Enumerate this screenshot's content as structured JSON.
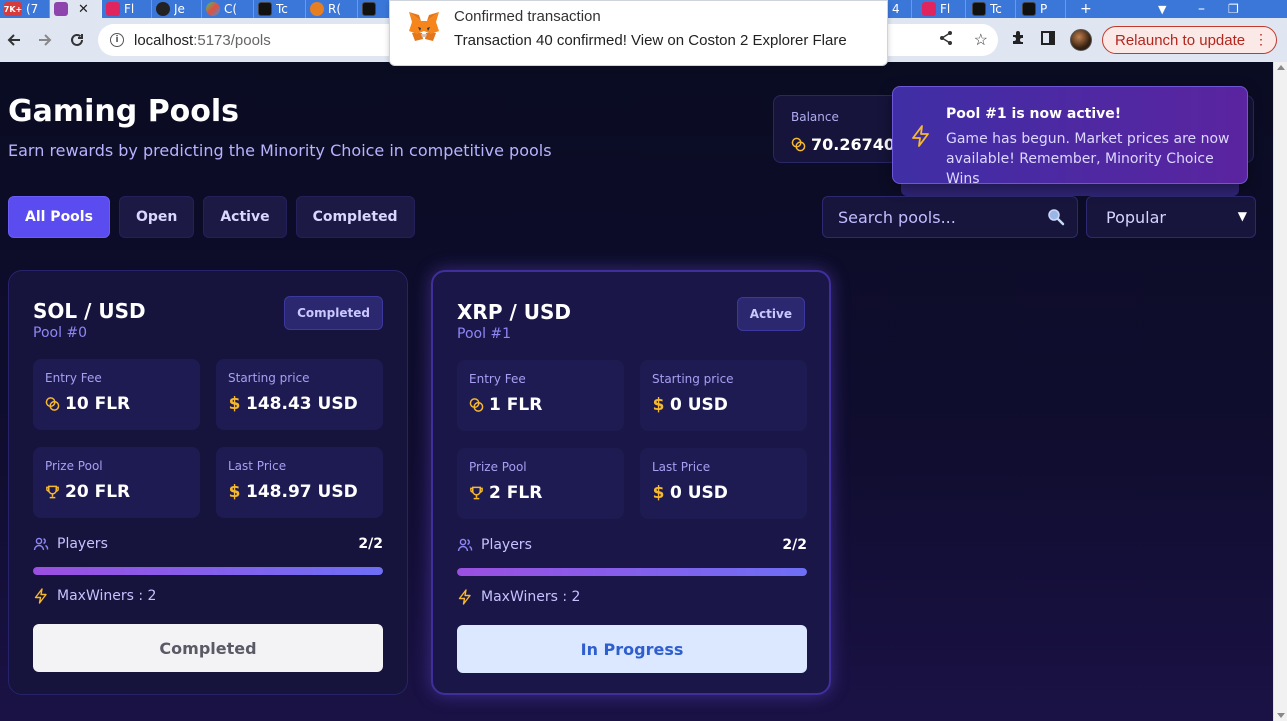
{
  "browser": {
    "tabs": [
      {
        "title": "(7",
        "badge": "7K+"
      },
      {
        "title": "",
        "active": true
      },
      {
        "title": "Fl"
      },
      {
        "title": "Je"
      },
      {
        "title": "C("
      },
      {
        "title": "Tc"
      },
      {
        "title": "R("
      },
      {
        "title": ""
      }
    ],
    "tabs_right": [
      {
        "title": "4"
      },
      {
        "title": "Fl"
      },
      {
        "title": "Tc"
      },
      {
        "title": "P"
      }
    ],
    "url_host": "localhost",
    "url_path": ":5173/pools",
    "relaunch_label": "Relaunch to update"
  },
  "metamask": {
    "title": "Confirmed transaction",
    "message": "Transaction 40 confirmed! View on Coston 2 Explorer Flare"
  },
  "page": {
    "title": "Gaming Pools",
    "subtitle": "Earn rewards by predicting the Minority Choice in competitive pools",
    "filters": [
      "All Pools",
      "Open",
      "Active",
      "Completed"
    ],
    "active_filter": "All Pools",
    "search_placeholder": "Search pools...",
    "sort_value": "Popular"
  },
  "balance": {
    "label": "Balance",
    "value": "70.2674060"
  },
  "toast": {
    "title": "Pool #1 is now active!",
    "message": "Game has begun. Market prices are now available! Remember, Minority Choice Wins"
  },
  "pools": [
    {
      "name": "SOL / USD",
      "id_label": "Pool #0",
      "status": "Completed",
      "entry_fee_label": "Entry Fee",
      "entry_fee": "10 FLR",
      "starting_price_label": "Starting price",
      "starting_price": "148.43 USD",
      "prize_pool_label": "Prize Pool",
      "prize_pool": "20 FLR",
      "last_price_label": "Last Price",
      "last_price": "148.97 USD",
      "players_label": "Players",
      "players": "2/2",
      "players_fill": 1.0,
      "max_winners": "MaxWiners : 2",
      "action": "Completed"
    },
    {
      "name": "XRP / USD",
      "id_label": "Pool #1",
      "status": "Active",
      "entry_fee_label": "Entry Fee",
      "entry_fee": "1 FLR",
      "starting_price_label": "Starting price",
      "starting_price": "0 USD",
      "prize_pool_label": "Prize Pool",
      "prize_pool": "2 FLR",
      "last_price_label": "Last Price",
      "last_price": "0 USD",
      "players_label": "Players",
      "players": "2/2",
      "players_fill": 1.0,
      "max_winners": "MaxWiners : 2",
      "action": "In Progress"
    }
  ],
  "colors": {
    "accent": "#5b4cf0",
    "gold": "#f5b82e",
    "background": "#0b0d24"
  }
}
